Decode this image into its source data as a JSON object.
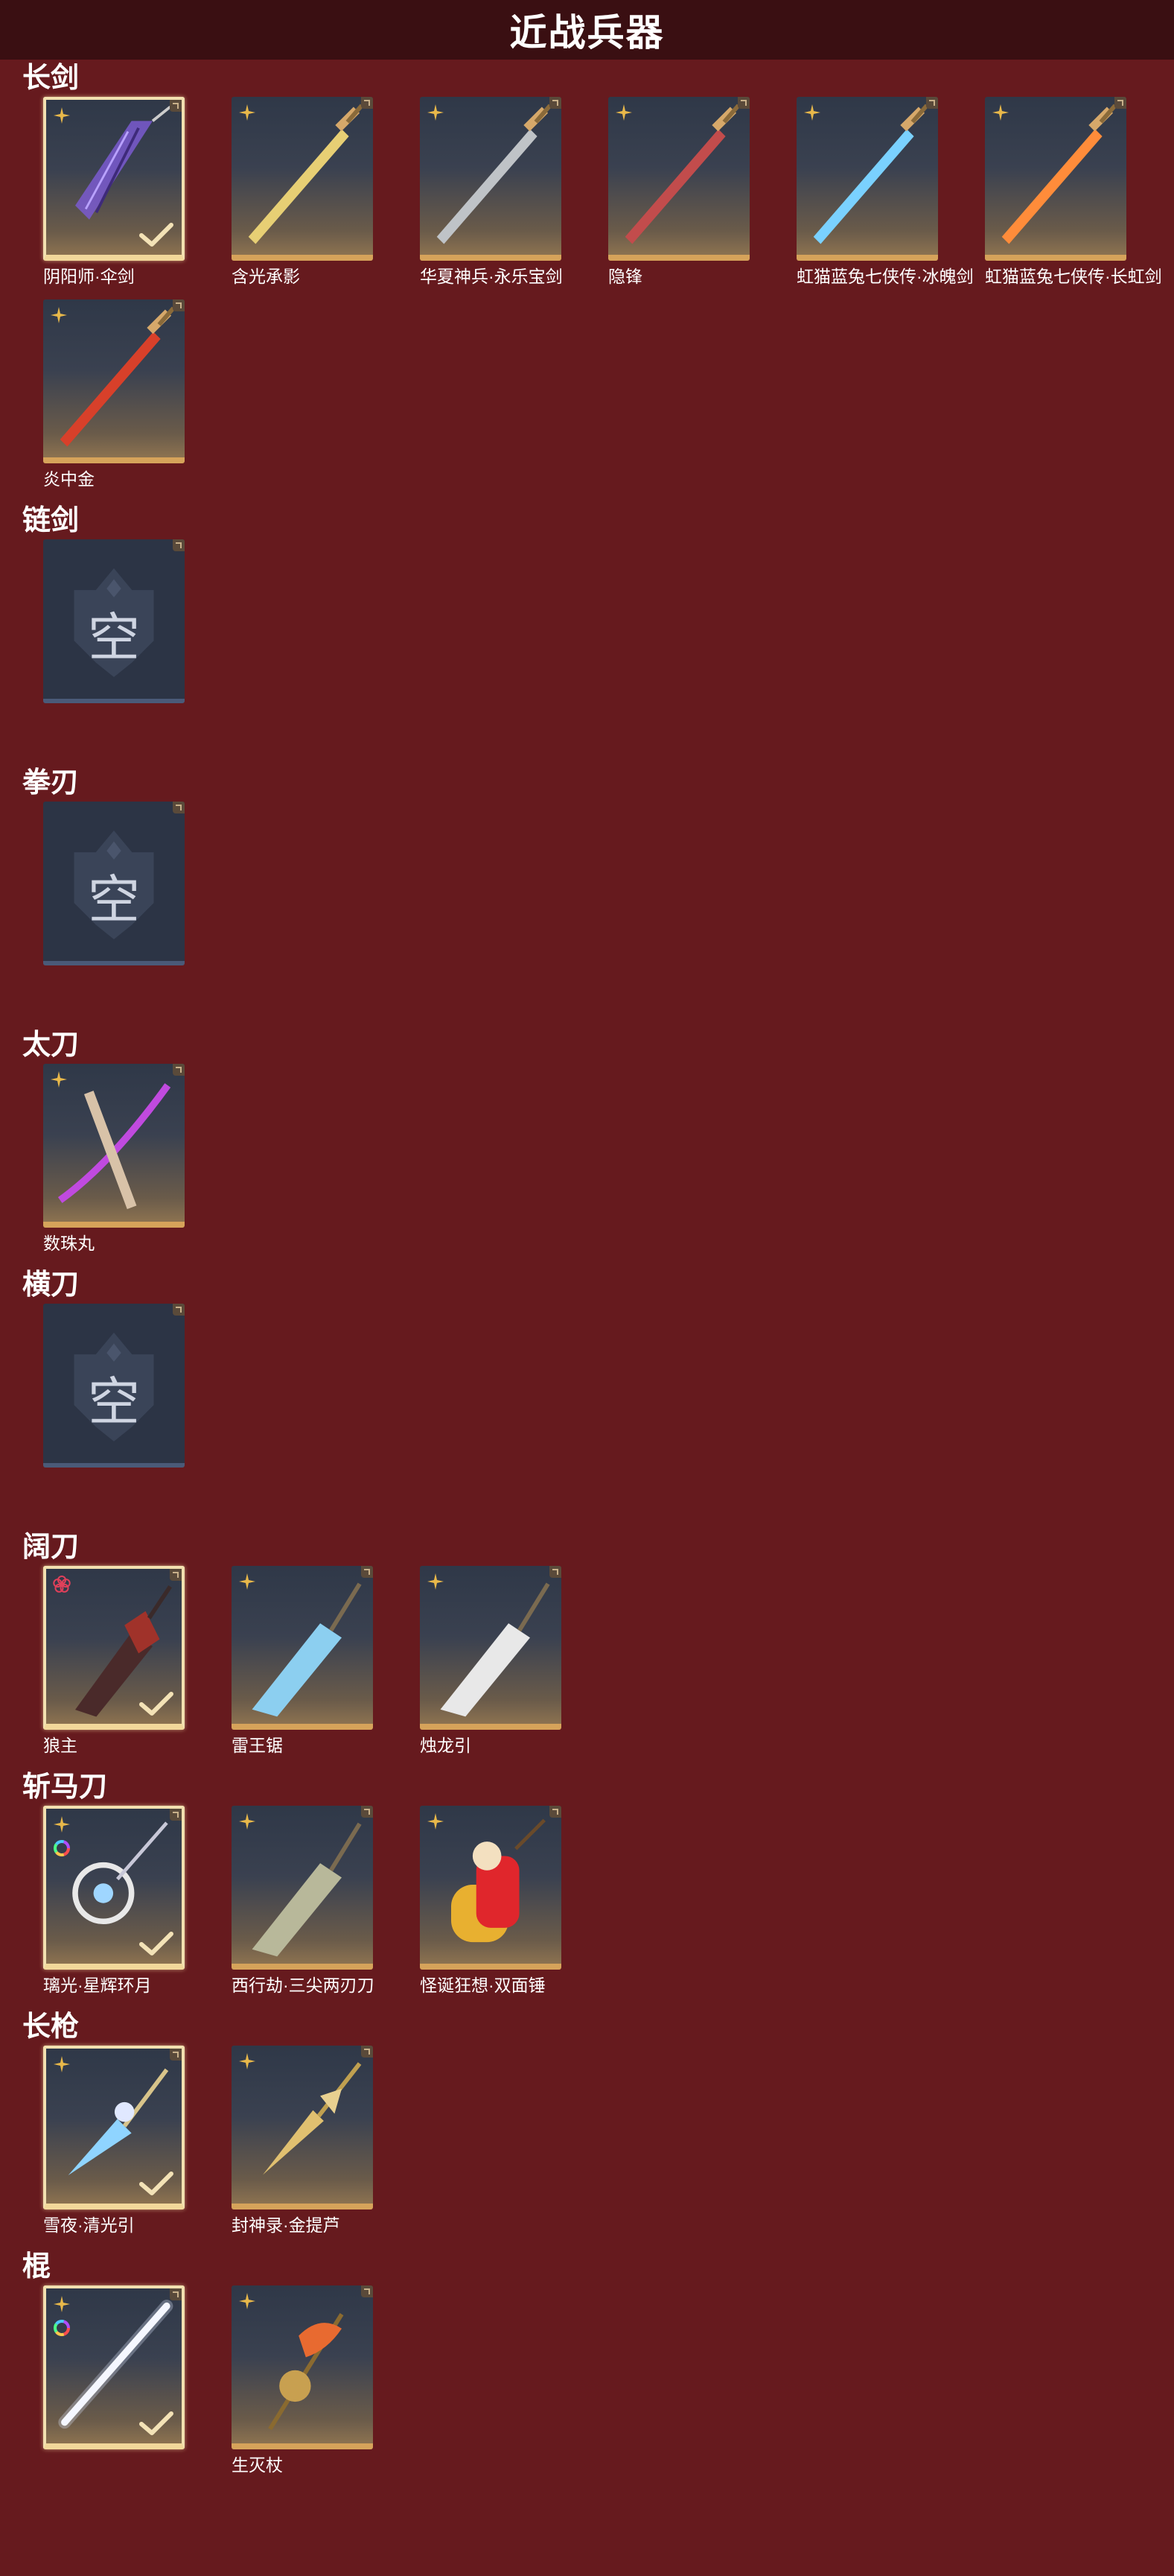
{
  "header": {
    "title": "近战兵器"
  },
  "sections": [
    {
      "title": "长剑",
      "items": [
        {
          "label": "阴阳师·伞剑",
          "equipped": true,
          "rank": "gold-shuriken",
          "ring": false,
          "art": "umbrella-sword",
          "color": "#7a5ad0"
        },
        {
          "label": "含光承影",
          "equipped": false,
          "rank": "gold-shuriken",
          "ring": false,
          "art": "gold-sword",
          "color": "#e7cf74"
        },
        {
          "label": "华夏神兵·永乐宝剑",
          "equipped": false,
          "rank": "gold-shuriken",
          "ring": false,
          "art": "steel-sword",
          "color": "#bfc3c7"
        },
        {
          "label": "隐锋",
          "equipped": false,
          "rank": "gold-shuriken",
          "ring": false,
          "art": "hidden-blade",
          "color": "#c24c4c"
        },
        {
          "label": "虹猫蓝兔七侠传·冰魄剑",
          "equipped": false,
          "rank": "gold-shuriken",
          "ring": false,
          "art": "ice-sword",
          "color": "#7ad1ff"
        },
        {
          "label": "虹猫蓝兔七侠传·长虹剑",
          "equipped": false,
          "rank": "gold-shuriken",
          "ring": false,
          "art": "fire-sword",
          "color": "#ff8c3a"
        },
        {
          "label": "炎中金",
          "equipped": false,
          "rank": "gold-shuriken",
          "ring": false,
          "art": "flame-sword",
          "color": "#d8402a"
        }
      ]
    },
    {
      "title": "链剑",
      "items": [
        {
          "label": "",
          "empty": true,
          "empty_text": "空"
        }
      ]
    },
    {
      "title": "拳刃",
      "items": [
        {
          "label": "",
          "empty": true,
          "empty_text": "空"
        }
      ]
    },
    {
      "title": "太刀",
      "items": [
        {
          "label": "数珠丸",
          "equipped": false,
          "rank": "gold-shuriken",
          "ring": false,
          "art": "katana",
          "color": "#c04adf"
        }
      ]
    },
    {
      "title": "横刀",
      "items": [
        {
          "label": "",
          "empty": true,
          "empty_text": "空"
        }
      ]
    },
    {
      "title": "阔刀",
      "items": [
        {
          "label": "狼主",
          "equipped": true,
          "rank": "red-flower",
          "ring": false,
          "art": "wolf-blade",
          "color": "#a0322a"
        },
        {
          "label": "雷王锯",
          "equipped": false,
          "rank": "gold-shuriken",
          "ring": false,
          "art": "thunder-saw",
          "color": "#8ccff0"
        },
        {
          "label": "烛龙引",
          "equipped": false,
          "rank": "gold-shuriken",
          "ring": false,
          "art": "dragon-blade",
          "color": "#e8e8e8"
        }
      ]
    },
    {
      "title": "斩马刀",
      "items": [
        {
          "label": "璃光·星辉环月",
          "equipped": true,
          "rank": "gold-shuriken",
          "ring": true,
          "art": "moon-blade",
          "color": "#9fd6ff"
        },
        {
          "label": "西行劫·三尖两刃刀",
          "equipped": false,
          "rank": "gold-shuriken",
          "ring": false,
          "art": "trident-blade",
          "color": "#b8b89a"
        },
        {
          "label": "怪诞狂想·双面锤",
          "equipped": false,
          "rank": "gold-shuriken",
          "ring": false,
          "art": "hammer",
          "color": "#e0262c"
        }
      ]
    },
    {
      "title": "长枪",
      "items": [
        {
          "label": "雪夜·清光引",
          "equipped": true,
          "rank": "gold-shuriken",
          "ring": false,
          "art": "ice-spear",
          "color": "#8fd4ff"
        },
        {
          "label": "封神录·金提芦",
          "equipped": false,
          "rank": "gold-shuriken",
          "ring": false,
          "art": "gold-spear",
          "color": "#e0c070"
        }
      ]
    },
    {
      "title": "棍",
      "items": [
        {
          "label": "",
          "equipped": true,
          "rank": "gold-shuriken",
          "ring": true,
          "art": "light-staff",
          "color": "#ffffff"
        },
        {
          "label": "生灭杖",
          "equipped": false,
          "rank": "gold-shuriken",
          "ring": false,
          "art": "flame-staff",
          "color": "#e86a30"
        }
      ]
    }
  ]
}
